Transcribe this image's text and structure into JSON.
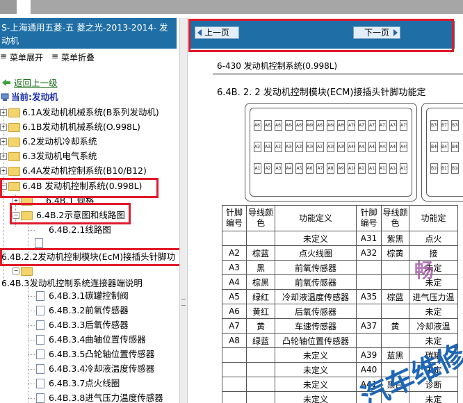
{
  "left_pane": {
    "header_title": "S-上海通用五菱-五 菱之光-2013-2014- 发动机",
    "menu_expand": "菜单展开",
    "menu_collapse": "菜单折叠",
    "back_link": "返回上一级",
    "current": "当前:发动机",
    "tree": [
      {
        "label": "6.1A发动机机械系统(B系列发动机)"
      },
      {
        "label": "6.1B发动机机械系统(O.998L)"
      },
      {
        "label": "6.2发动机冷却系统"
      },
      {
        "label": "6.3发动机电气系统"
      },
      {
        "label": "6.4A发动机控制系统(B10/B12)"
      },
      {
        "label": "6.4B 发动机控制系统(0.998L)"
      },
      {
        "label": "6.4B.1 规格"
      },
      {
        "label": "6.4B.2示意图和线路图"
      },
      {
        "label": "6.4B.2.1线路图"
      },
      {
        "label": "6.4B.2.2发动机控制模块(EcM)接插头针脚功"
      },
      {
        "label": "6.4B.3发动机控制系统连接器端说明"
      },
      {
        "label": "6.4B.3.1碳罐控制阀"
      },
      {
        "label": "6.4B.3.2前氧传感器"
      },
      {
        "label": "6.4B.3.3后氧传感器"
      },
      {
        "label": "6.4B.3.4曲轴位置传感器"
      },
      {
        "label": "6.4B.3.5凸轮轴位置传感器"
      },
      {
        "label": "6.4B.3.4冷却液温度传感器"
      },
      {
        "label": "6.4B.3.7点火线圈"
      },
      {
        "label": "6.4B.3.8进气压力温度传感器"
      }
    ]
  },
  "nav": {
    "prev": "上一页",
    "next": "下一页"
  },
  "doc": {
    "page_title": "6-430 发动机控制系统(0.998L)",
    "section_title": "6.4B. 2. 2  发动机控制模块(ECM)接插头针脚功能定",
    "connector_rows_a": [
      [
        "A61",
        "A62",
        "A63",
        "A64",
        "A65",
        "A66",
        "A67",
        "A68",
        "A69",
        "A70",
        "A71",
        "A72",
        "A73",
        "A74",
        "A75"
      ],
      [
        "A31",
        "A32",
        "A33",
        "A34",
        "A35",
        "A36",
        "A37",
        "A38",
        "A39",
        "A40",
        "A41",
        "A42",
        "A43",
        "A44",
        "A45"
      ],
      [
        "A1",
        "A2",
        "A3",
        "A4",
        "A5",
        "A6",
        "A7",
        "A8",
        "A9",
        "A10",
        "A11",
        "A12",
        "A13",
        "A14",
        "A15"
      ]
    ],
    "connector_rows_b": [
      [
        "B76",
        "B77",
        "B78"
      ],
      [
        "B46",
        "B47",
        "B48"
      ],
      [
        "B16",
        "B17",
        "B18"
      ]
    ],
    "table_headers": [
      "针脚编号",
      "导线颜色",
      "功能定义",
      "针脚编号",
      "导线颜色",
      "功能定"
    ],
    "table_rows": [
      [
        "",
        "",
        "未定义",
        "A31",
        "紫黑",
        "点火"
      ],
      [
        "A2",
        "棕蓝",
        "点火线圈",
        "A32",
        "棕黄",
        "接"
      ],
      [
        "A3",
        "黑",
        "前氧传感器",
        "",
        "",
        "未定"
      ],
      [
        "A4",
        "棕黑",
        "前氧传感器",
        "",
        "",
        "未定"
      ],
      [
        "A5",
        "绿红",
        "冷却液温度传感器",
        "A35",
        "棕蓝",
        "进气压力温"
      ],
      [
        "A6",
        "黄红",
        "后氧传感器",
        "",
        "",
        "未定"
      ],
      [
        "A7",
        "黄",
        "车速传感器",
        "A37",
        "黄",
        "冷却液温"
      ],
      [
        "A8",
        "绿蓝",
        "凸轮轴位置传感器",
        "",
        "",
        "未定"
      ],
      [
        "",
        "",
        "未定义",
        "A39",
        "蓝黑",
        "碳罐"
      ],
      [
        "",
        "",
        "未定义",
        "A40",
        "",
        "未定"
      ],
      [
        "",
        "",
        "未定义",
        "A41",
        "黑白",
        "诊断"
      ],
      [
        "",
        "",
        "未定义",
        "",
        "",
        "未定"
      ]
    ]
  },
  "watermarks": [
    "畅",
    "汽车维修"
  ],
  "colors": {
    "header_blue": "#1f6fa6",
    "highlight_red": "#e11a2b",
    "folder_yellow": "#f5d36b"
  }
}
